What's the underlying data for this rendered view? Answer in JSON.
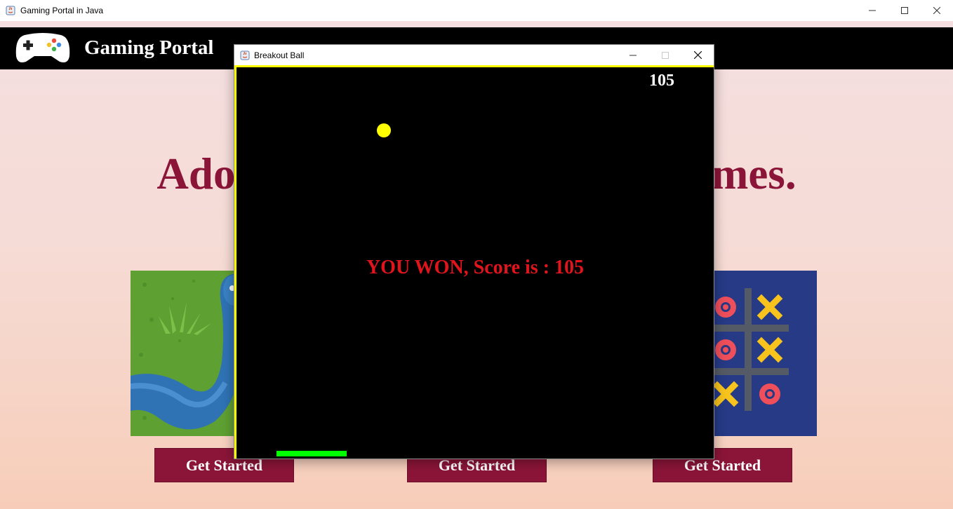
{
  "window": {
    "title": "Gaming Portal in Java"
  },
  "header": {
    "app_title": "Gaming Portal"
  },
  "main": {
    "headline": "Adorn your time with our Games.",
    "buttons": [
      "Get Started",
      "Get Started",
      "Get Started"
    ]
  },
  "game_window": {
    "title": "Breakout Ball",
    "score": "105",
    "message": "YOU WON, Score is : 105"
  },
  "colors": {
    "brand": "#8b1538",
    "header_bg": "#000000",
    "ball": "#ffff00",
    "paddle": "#00ff00",
    "message": "#e0141c"
  },
  "icons": [
    "java-icon",
    "gamepad-logo-icon",
    "minimize-icon",
    "maximize-icon",
    "close-icon"
  ]
}
